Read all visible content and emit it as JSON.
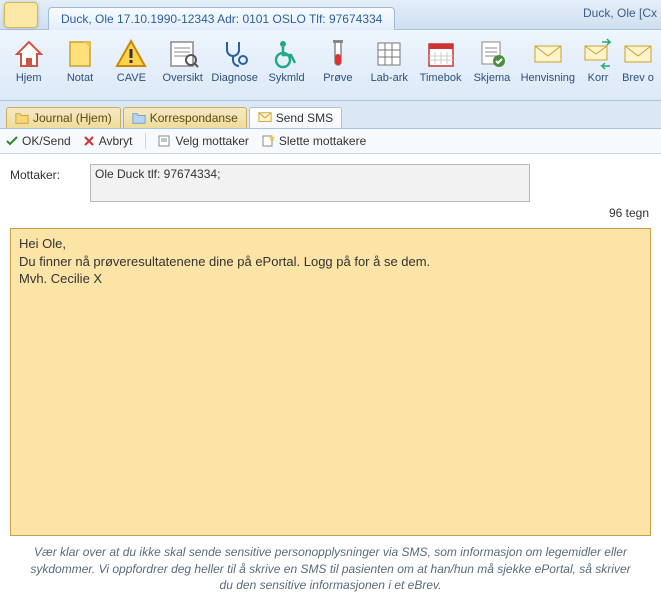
{
  "title_right": "Duck, Ole [Cx",
  "patient_tab": "Duck, Ole 17.10.1990-12343 Adr: 0101 OSLO Tlf: 97674334",
  "ribbon": [
    {
      "label": "Hjem"
    },
    {
      "label": "Notat"
    },
    {
      "label": "CAVE"
    },
    {
      "label": "Oversikt"
    },
    {
      "label": "Diagnose"
    },
    {
      "label": "Sykmld"
    },
    {
      "label": "Prøve"
    },
    {
      "label": "Lab-ark"
    },
    {
      "label": "Timebok"
    },
    {
      "label": "Skjema"
    },
    {
      "label": "Henvisning"
    },
    {
      "label": "Korr"
    },
    {
      "label": "Brev o"
    }
  ],
  "subtabs": [
    {
      "label": "Journal (Hjem)"
    },
    {
      "label": "Korrespondanse"
    },
    {
      "label": "Send SMS"
    }
  ],
  "actions": {
    "ok": "OK/Send",
    "cancel": "Avbryt",
    "select": "Velg mottaker",
    "delete": "Slette mottakere"
  },
  "mottaker_label": "Mottaker:",
  "mottaker_value": "Ole Duck tlf: 97674334;",
  "char_count": "96 tegn",
  "message": "Hei Ole,\nDu finner nå prøveresultatenene dine på ePortal. Logg på for å se dem.\nMvh. Cecilie X",
  "disclaimer": "Vær klar over at du ikke skal sende sensitive personopplysninger via SMS, som informasjon om legemidler eller sykdommer. Vi oppfordrer deg heller til å skrive en SMS til pasienten om at han/hun må sjekke ePortal, så skriver du den sensitive informasjonen i et eBrev."
}
